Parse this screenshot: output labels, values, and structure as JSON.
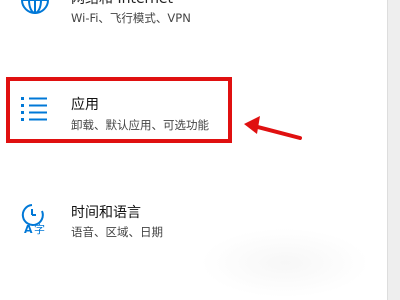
{
  "settings": {
    "items": [
      {
        "id": "network",
        "title": "网络和 Internet",
        "subtitle": "Wi-Fi、飞行模式、VPN",
        "icon": "globe-icon"
      },
      {
        "id": "apps",
        "title": "应用",
        "subtitle": "卸载、默认应用、可选功能",
        "icon": "apps-list-icon"
      },
      {
        "id": "time-language",
        "title": "时间和语言",
        "subtitle": "语音、区域、日期",
        "icon": "time-language-icon"
      }
    ]
  },
  "annotation": {
    "highlight_color": "#e01010",
    "arrow_color": "#e01010"
  },
  "colors": {
    "accent": "#0078d7",
    "title_text": "#111111",
    "subtitle_text": "#444444"
  }
}
